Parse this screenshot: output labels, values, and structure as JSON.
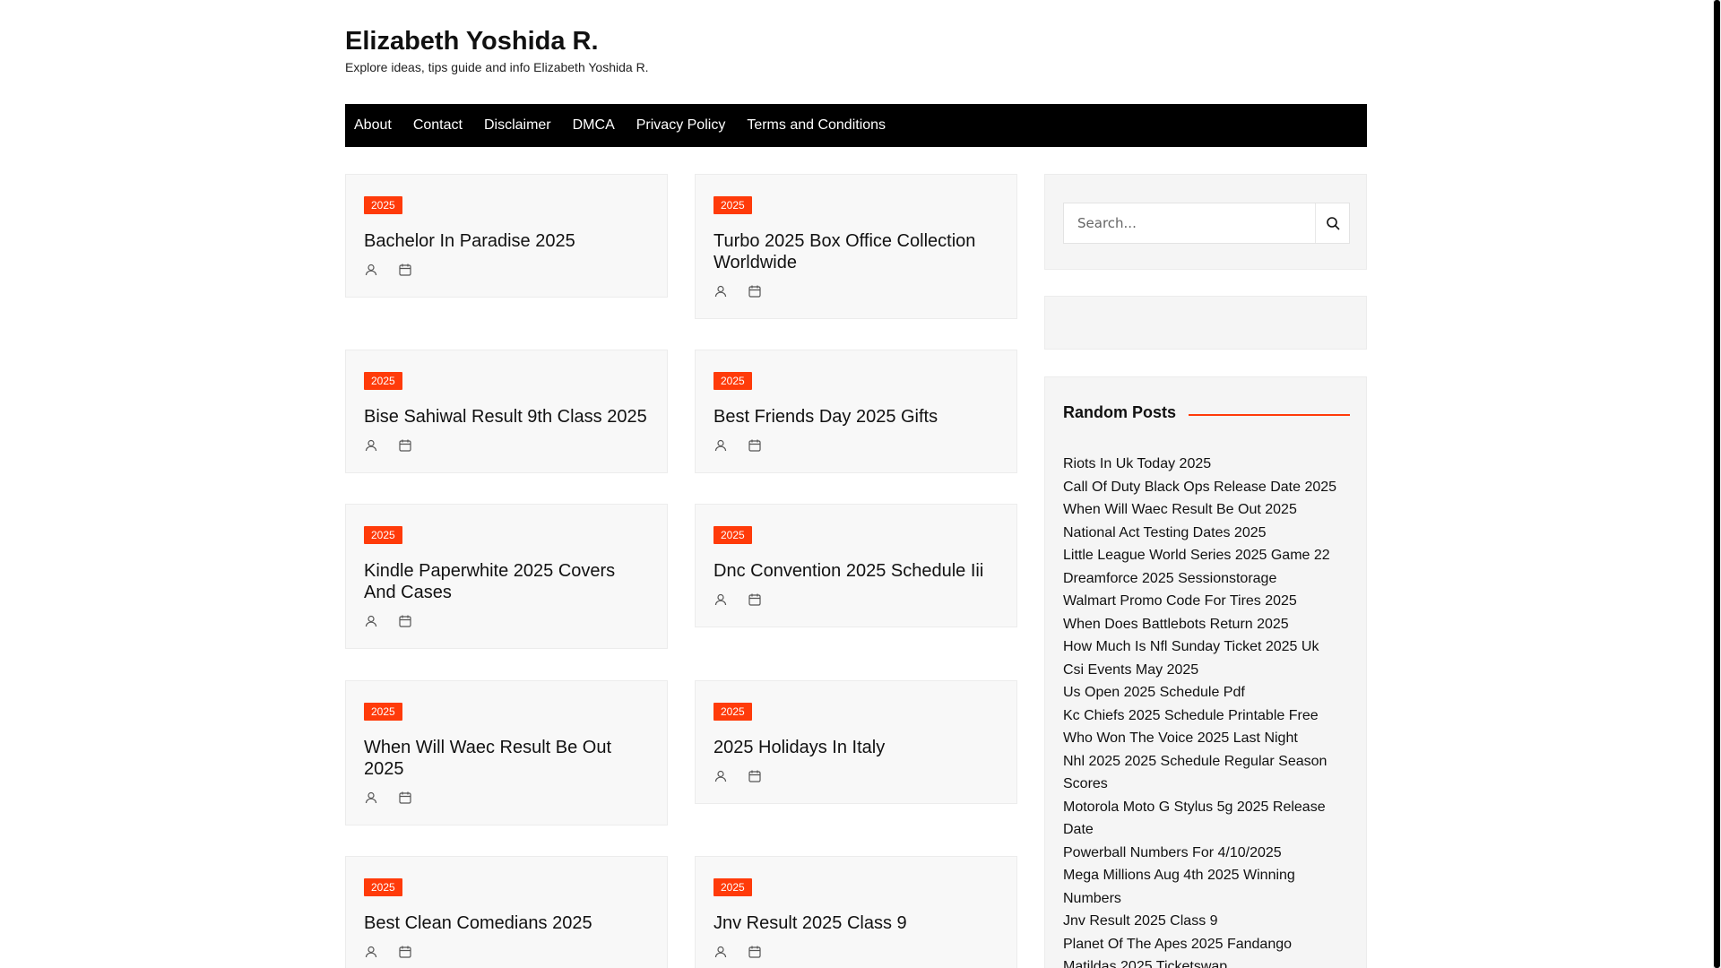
{
  "site": {
    "title": "Elizabeth Yoshida R.",
    "description": "Explore ideas, tips guide and info Elizabeth Yoshida R."
  },
  "nav": [
    "About",
    "Contact",
    "Disclaimer",
    "DMCA",
    "Privacy Policy",
    "Terms and Conditions"
  ],
  "posts": [
    {
      "badge": "2025",
      "title": "Bachelor In Paradise 2025"
    },
    {
      "badge": "2025",
      "title": "Turbo 2025 Box Office Collection Worldwide"
    },
    {
      "badge": "2025",
      "title": "Bise Sahiwal Result 9th Class 2025"
    },
    {
      "badge": "2025",
      "title": "Best Friends Day 2025 Gifts"
    },
    {
      "badge": "2025",
      "title": "Kindle Paperwhite 2025 Covers And Cases"
    },
    {
      "badge": "2025",
      "title": "Dnc Convention 2025 Schedule Iii"
    },
    {
      "badge": "2025",
      "title": "When Will Waec Result Be Out 2025"
    },
    {
      "badge": "2025",
      "title": "2025 Holidays In Italy"
    },
    {
      "badge": "2025",
      "title": "Best Clean Comedians 2025"
    },
    {
      "badge": "2025",
      "title": "Jnv Result 2025 Class 9"
    }
  ],
  "search": {
    "placeholder": "Search..."
  },
  "random_posts": {
    "title": "Random Posts",
    "items": [
      "Riots In Uk Today 2025",
      "Call Of Duty Black Ops Release Date 2025",
      "When Will Waec Result Be Out 2025",
      "National Act Testing Dates 2025",
      "Little League World Series 2025 Game 22",
      "Dreamforce 2025 Sessionstorage",
      "Walmart Promo Code For Tires 2025",
      "When Does Battlebots Return 2025",
      "How Much Is Nfl Sunday Ticket 2025 Uk",
      "Csi Events May 2025",
      "Us Open 2025 Schedule Pdf",
      "Kc Chiefs 2025 Schedule Printable Free",
      "Who Won The Voice 2025 Last Night",
      "Nhl 2025 2025 Schedule Regular Season Scores",
      "Motorola Moto G Stylus 5g 2025 Release Date",
      "Powerball Numbers For 4/10/2025",
      "Mega Millions Aug 4th 2025 Winning Numbers",
      "Jnv Result 2025 Class 9",
      "Planet Of The Apes 2025 Fandango",
      "Matildas 2025 Ticketswap"
    ]
  },
  "colors": {
    "accent": "#ff3b0a",
    "nav_bg": "#000000",
    "card_bg": "#f8f8f8"
  }
}
